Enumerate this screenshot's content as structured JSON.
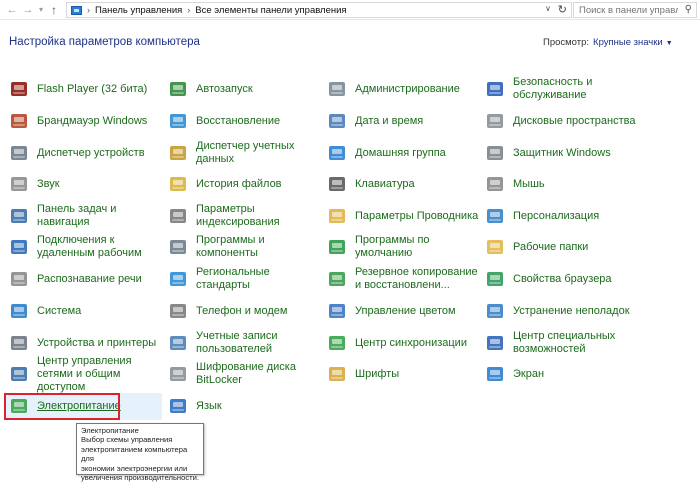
{
  "address": {
    "crumbs": [
      "Панель управления",
      "Все элементы панели управления"
    ],
    "search_placeholder": "Поиск в панели управления"
  },
  "page_title": "Настройка параметров компьютера",
  "view_by": {
    "label": "Просмотр:",
    "value": "Крупные значки"
  },
  "items": [
    {
      "id": "flash",
      "label": "Flash Player (32 бита)",
      "icon": "flash-player-icon",
      "color": "#8b1a0e"
    },
    {
      "id": "autoplay",
      "label": "Автозапуск",
      "icon": "autoplay-icon",
      "color": "#2f8a3c"
    },
    {
      "id": "admin",
      "label": "Администрирование",
      "icon": "administration-icon",
      "color": "#7a8a96"
    },
    {
      "id": "security",
      "label": "Безопасность и обслуживание",
      "icon": "security-flag-icon",
      "color": "#2a5fb8"
    },
    {
      "id": "firewall",
      "label": "Брандмауэр Windows",
      "icon": "firewall-icon",
      "color": "#b2472b"
    },
    {
      "id": "recovery",
      "label": "Восстановление",
      "icon": "recovery-icon",
      "color": "#2f8ccf"
    },
    {
      "id": "datetime",
      "label": "Дата и время",
      "icon": "date-time-icon",
      "color": "#4a7db8"
    },
    {
      "id": "storage",
      "label": "Дисковые пространства",
      "icon": "storage-spaces-icon",
      "color": "#8a8f96"
    },
    {
      "id": "devmgr",
      "label": "Диспетчер устройств",
      "icon": "device-manager-icon",
      "color": "#6b7a8a"
    },
    {
      "id": "credmgr",
      "label": "Диспетчер учетных данных",
      "icon": "credential-manager-icon",
      "color": "#c49a2e"
    },
    {
      "id": "homegroup",
      "label": "Домашняя группа",
      "icon": "homegroup-icon",
      "color": "#2d7fd0"
    },
    {
      "id": "defender",
      "label": "Защитник Windows",
      "icon": "defender-icon",
      "color": "#7d8389"
    },
    {
      "id": "sound",
      "label": "Звук",
      "icon": "sound-icon",
      "color": "#8c8c8c"
    },
    {
      "id": "filehistory",
      "label": "История файлов",
      "icon": "file-history-icon",
      "color": "#d8b23a"
    },
    {
      "id": "keyboard",
      "label": "Клавиатура",
      "icon": "keyboard-icon",
      "color": "#5a5a5a"
    },
    {
      "id": "mouse",
      "label": "Мышь",
      "icon": "mouse-icon",
      "color": "#8a8a8a"
    },
    {
      "id": "taskbar",
      "label": "Панель задач и навигация",
      "icon": "taskbar-icon",
      "color": "#3a6ea8"
    },
    {
      "id": "indexing",
      "label": "Параметры индексирования",
      "icon": "indexing-icon",
      "color": "#7a7a7a"
    },
    {
      "id": "explorer",
      "label": "Параметры Проводника",
      "icon": "explorer-options-icon",
      "color": "#e0b443"
    },
    {
      "id": "personalization",
      "label": "Персонализация",
      "icon": "personalization-icon",
      "color": "#3583c8"
    },
    {
      "id": "remoteapp",
      "label": "Подключения к удаленным рабочим",
      "icon": "remote-app-icon",
      "color": "#2a6bb5"
    },
    {
      "id": "programs",
      "label": "Программы и компоненты",
      "icon": "programs-icon",
      "color": "#6f7d8a"
    },
    {
      "id": "defaults",
      "label": "Программы по умолчанию",
      "icon": "default-programs-icon",
      "color": "#2e9a48"
    },
    {
      "id": "workfolders",
      "label": "Рабочие папки",
      "icon": "work-folders-icon",
      "color": "#e2b64a"
    },
    {
      "id": "speech",
      "label": "Распознавание речи",
      "icon": "speech-recognition-icon",
      "color": "#8a8a8a"
    },
    {
      "id": "region",
      "label": "Региональные стандарты",
      "icon": "region-icon",
      "color": "#2b8dd3"
    },
    {
      "id": "backup",
      "label": "Резервное копирование и восстановлени...",
      "icon": "backup-icon",
      "color": "#3b9b4a"
    },
    {
      "id": "internet",
      "label": "Свойства браузера",
      "icon": "internet-options-icon",
      "color": "#2f9a5c"
    },
    {
      "id": "system",
      "label": "Система",
      "icon": "system-icon",
      "color": "#2c7ec6"
    },
    {
      "id": "phone",
      "label": "Телефон и модем",
      "icon": "phone-modem-icon",
      "color": "#7b7b7b"
    },
    {
      "id": "color",
      "label": "Управление цветом",
      "icon": "color-management-icon",
      "color": "#3b76c0"
    },
    {
      "id": "troubleshoot",
      "label": "Устранение неполадок",
      "icon": "troubleshooting-icon",
      "color": "#3a7fc4"
    },
    {
      "id": "devices",
      "label": "Устройства и принтеры",
      "icon": "devices-printers-icon",
      "color": "#6d7780"
    },
    {
      "id": "accounts",
      "label": "Учетные записи пользователей",
      "icon": "user-accounts-icon",
      "color": "#4f7fb6"
    },
    {
      "id": "sync",
      "label": "Центр синхронизации",
      "icon": "sync-center-icon",
      "color": "#36a24a"
    },
    {
      "id": "ease",
      "label": "Центр специальных возможностей",
      "icon": "ease-of-access-icon",
      "color": "#2f66b8"
    },
    {
      "id": "network",
      "label": "Центр управления сетями и общим доступом",
      "icon": "network-center-icon",
      "color": "#3a6fa8"
    },
    {
      "id": "bitlocker",
      "label": "Шифрование диска BitLocker",
      "icon": "bitlocker-icon",
      "color": "#8a8f96"
    },
    {
      "id": "fonts",
      "label": "Шрифты",
      "icon": "fonts-icon",
      "color": "#d7a93a"
    },
    {
      "id": "display",
      "label": "Экран",
      "icon": "display-icon",
      "color": "#2b7fcf"
    },
    {
      "id": "power",
      "label": "Электропитание",
      "icon": "power-options-icon",
      "color": "#3aa14a"
    },
    {
      "id": "language",
      "label": "Язык",
      "icon": "language-icon",
      "color": "#2b6fc2"
    }
  ],
  "tooltip": {
    "lines": [
      "Электропитание",
      "Выбор схемы управления",
      "электропитанием компьютера для",
      "экономии электроэнергии или",
      "увеличения производительности."
    ]
  }
}
